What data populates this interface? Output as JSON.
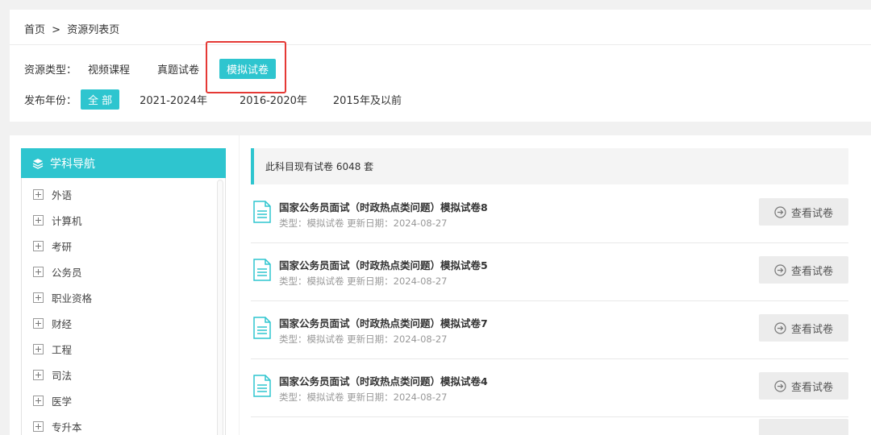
{
  "breadcrumb": {
    "home": "首页",
    "sep": ">",
    "current": "资源列表页"
  },
  "filters": {
    "type_label": "资源类型：",
    "type_options": [
      "视频课程",
      "真题试卷",
      "模拟试卷"
    ],
    "year_label": "发布年份：",
    "year_options": [
      "全 部",
      "2021-2024年",
      "2016-2020年",
      "2015年及以前"
    ]
  },
  "sidebar": {
    "title": "学科导航",
    "items": [
      "外语",
      "计算机",
      "考研",
      "公务员",
      "职业资格",
      "财经",
      "工程",
      "司法",
      "医学",
      "专升本"
    ]
  },
  "main": {
    "count_text": "此科目现有试卷 6048 套",
    "view_label": "查看试卷",
    "papers": [
      {
        "title": "国家公务员面试（时政热点类问题）模拟试卷8",
        "meta": "类型：模拟试卷 更新日期：2024-08-27"
      },
      {
        "title": "国家公务员面试（时政热点类问题）模拟试卷5",
        "meta": "类型：模拟试卷 更新日期：2024-08-27"
      },
      {
        "title": "国家公务员面试（时政热点类问题）模拟试卷7",
        "meta": "类型：模拟试卷 更新日期：2024-08-27"
      },
      {
        "title": "国家公务员面试（时政热点类问题）模拟试卷4",
        "meta": "类型：模拟试卷 更新日期：2024-08-27"
      }
    ]
  },
  "colors": {
    "accent": "#2ec5cf",
    "highlight": "#e53935"
  },
  "icons": {
    "nav": "layers-icon",
    "paper": "document-icon",
    "view": "arrow-circle-icon",
    "expand": "plus-box-icon"
  }
}
